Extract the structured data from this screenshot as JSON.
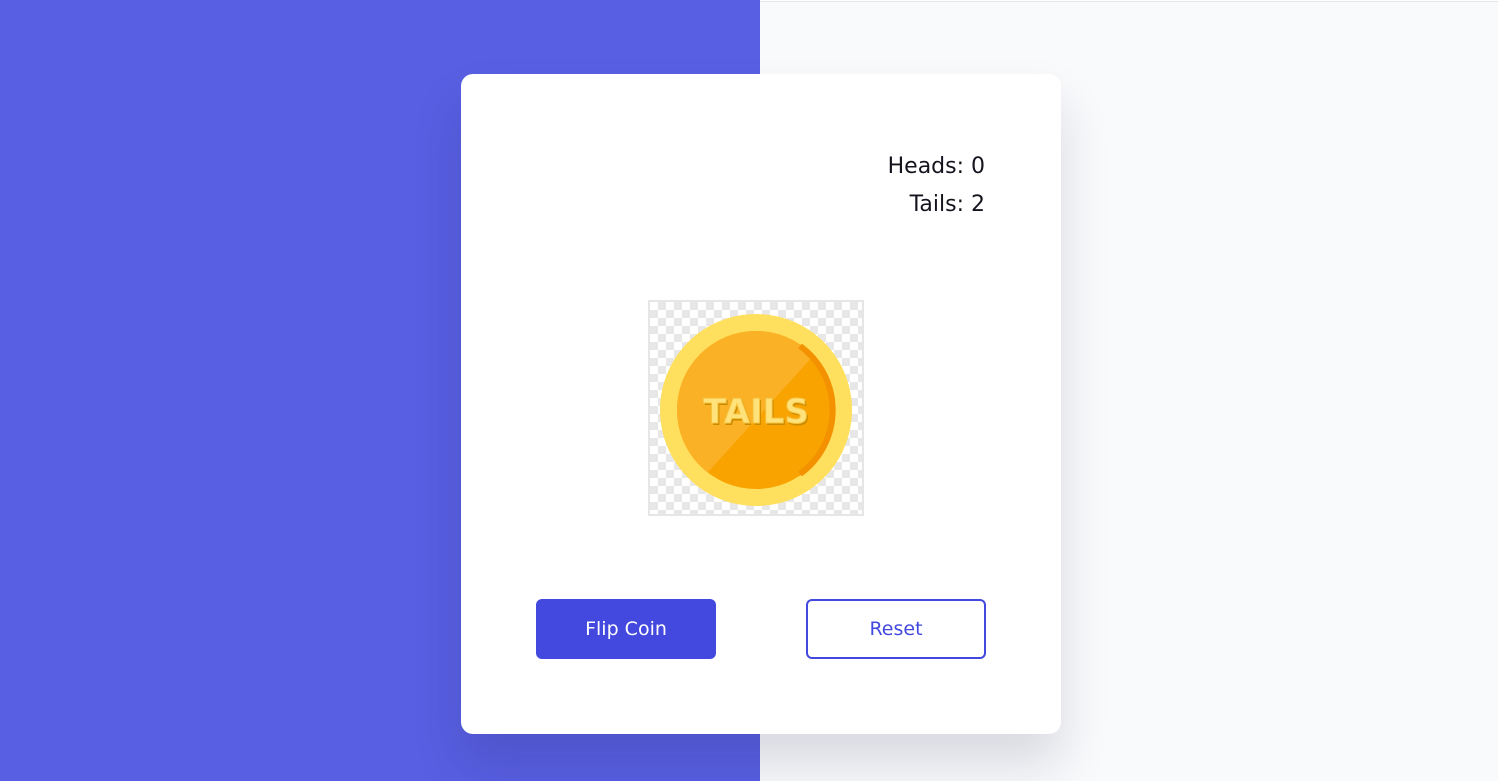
{
  "scores": {
    "heads_label": "Heads: 0",
    "tails_label": "Tails: 2"
  },
  "coin": {
    "face_text": "TAILS",
    "icon": "coin-icon"
  },
  "buttons": {
    "flip_label": "Flip Coin",
    "reset_label": "Reset"
  },
  "colors": {
    "background_left": "#585fe2",
    "background_right": "#f9fafc",
    "accent": "#4349de",
    "coin_outer": "#ffdd5c",
    "coin_inner": "#f8a400"
  }
}
